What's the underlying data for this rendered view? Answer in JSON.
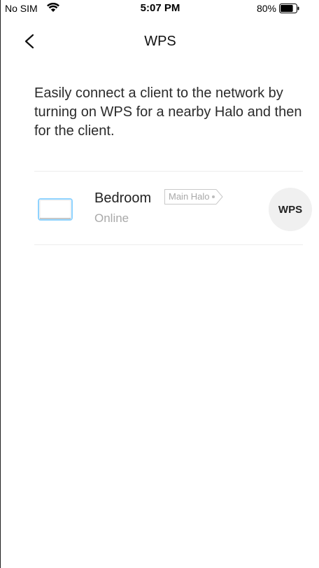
{
  "status_bar": {
    "carrier": "No SIM",
    "time": "5:07 PM",
    "battery": "80%",
    "battery_level": 0.8,
    "wifi_icon": "wifi-icon",
    "battery_icon": "battery-icon"
  },
  "nav": {
    "title": "WPS",
    "back_icon": "chevron-left-icon"
  },
  "description": "Easily connect a client to the network by turning on WPS for a nearby Halo and then for the client.",
  "device": {
    "name": "Bedroom",
    "tag": "Main Halo",
    "status": "Online",
    "icon": "halo-device-icon",
    "wps_label": "WPS"
  },
  "colors": {
    "background": "#ffffff",
    "text": "#222222",
    "muted": "#a9a9a9",
    "device_glow": "#8fd3ff",
    "button_bg": "#f0f0f0"
  }
}
